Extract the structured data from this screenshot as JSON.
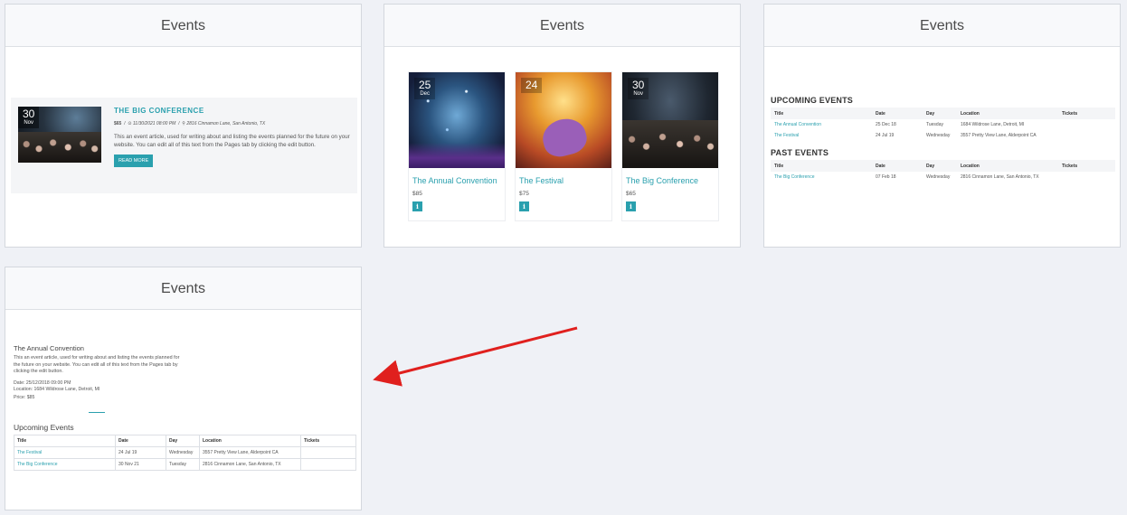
{
  "cards": {
    "list": {
      "header": "Events",
      "event": {
        "day": "30",
        "month": "Nov",
        "title": "THE BIG CONFERENCE",
        "price": "$65",
        "datetime": "11/30/2021 08:00 PM",
        "location": "2816 Cinnamon Lane, San Antonio, TX",
        "description": "This an event article, used for writing about and listing the events planned for the future on your website. You can edit all of this text from the Pages tab by clicking the edit button.",
        "button": "READ MORE"
      }
    },
    "grid": {
      "header": "Events",
      "items": [
        {
          "day": "25",
          "month": "Dec",
          "title": "The Annual Convention",
          "price": "$85",
          "icon": "i"
        },
        {
          "day": "24",
          "month": "",
          "title": "The Festival",
          "price": "$75",
          "icon": "i"
        },
        {
          "day": "30",
          "month": "Nov",
          "title": "The Big Conference",
          "price": "$65",
          "icon": "i"
        }
      ]
    },
    "table": {
      "header": "Events",
      "upcoming_heading": "UPCOMING EVENTS",
      "past_heading": "PAST EVENTS",
      "columns": [
        "Title",
        "Date",
        "Day",
        "Location",
        "Tickets"
      ],
      "upcoming": [
        [
          "The Annual Convention",
          "25 Dec 18",
          "Tuesday",
          "1684 Wildrose Lane, Detroit, MI",
          ""
        ],
        [
          "The Festival",
          "24 Jul 19",
          "Wednesday",
          "3557 Pretty View Lane, Alderpoint CA",
          ""
        ]
      ],
      "past": [
        [
          "The Big Conference",
          "07 Feb 18",
          "Wednesday",
          "2816 Cinnamon Lane, San Antonio, TX",
          ""
        ]
      ]
    },
    "detail": {
      "header": "Events",
      "title": "The Annual Convention",
      "description": "This an event article, used for writing about and listing the events planned for the future on your website. You can edit all of this text from the Pages tab by clicking the edit button.",
      "date": "Date: 25/12/2018 09:00 PM",
      "location": "Location: 1684 Wildrose Lane, Detroit, MI",
      "price": "Price: $85",
      "upcoming_heading": "Upcoming Events",
      "columns": [
        "Title",
        "Date",
        "Day",
        "Location",
        "Tickets"
      ],
      "rows": [
        [
          "The Festival",
          "24 Jul 19",
          "Wednesday",
          "3557 Pretty View Lane, Alderpoint CA",
          ""
        ],
        [
          "The Big Conference",
          "30 Nov 21",
          "Tuesday",
          "2816 Cinnamon Lane, San Antonio, TX",
          ""
        ]
      ]
    }
  },
  "colors": {
    "accent": "#2aa0ae",
    "arrow": "#e0201e",
    "background": "#eff1f6"
  }
}
